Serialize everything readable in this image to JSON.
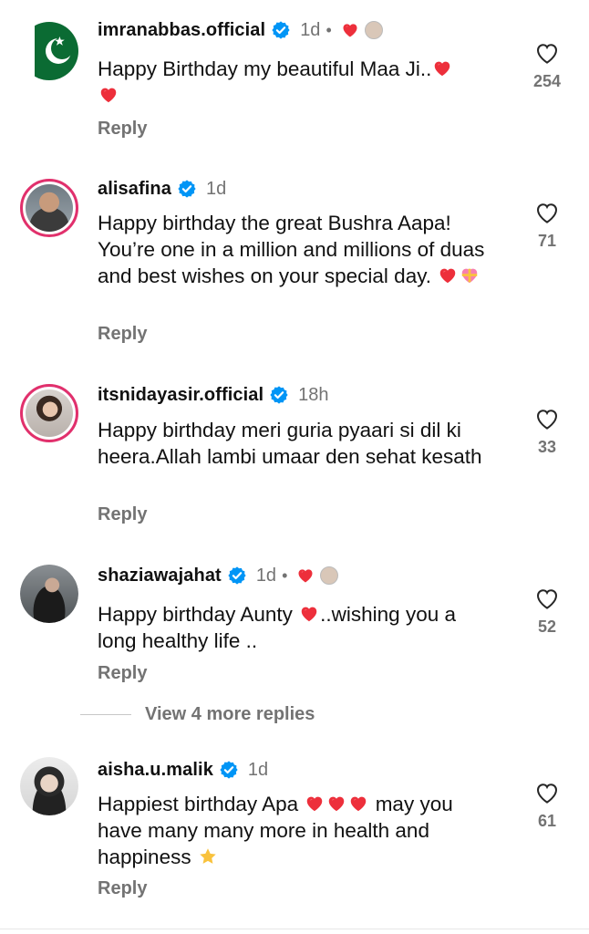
{
  "comments": [
    {
      "username": "imranabbas.official",
      "time": "1d",
      "text": "Happy Birthday my beautiful Maa Ji..",
      "reply": "Reply",
      "likes": "254"
    },
    {
      "username": "alisafina",
      "time": "1d",
      "text": "Happy birthday the great Bushra Aapa! You’re one in a million and millions of duas and best wishes on your special day.",
      "reply": "Reply",
      "likes": "71"
    },
    {
      "username": "itsnidayasir.official",
      "time": "18h",
      "text": "Happy birthday meri guria pyaari si dil ki heera.Allah lambi umaar den sehat kesath",
      "reply": "Reply",
      "likes": "33"
    },
    {
      "username": "shaziawajahat",
      "time": "1d",
      "text_before": "Happy birthday Aunty",
      "text_after": "..wishing you a long healthy life ..",
      "reply": "Reply",
      "likes": "52"
    },
    {
      "username": "aisha.u.malik",
      "time": "1d",
      "text_before": "Happiest birthday Apa",
      "text_after": "may you have many many more in health and happiness",
      "reply": "Reply",
      "likes": "61"
    }
  ],
  "view_more": "View 4 more replies",
  "colors": {
    "verified": "#0095f6",
    "heart": "#ed2f3b",
    "muted": "#737373"
  },
  "icons": [
    "verified-badge-icon",
    "heart-outline-icon",
    "heart-filled-icon",
    "star-emoji-icon",
    "gift-heart-emoji-icon"
  ]
}
